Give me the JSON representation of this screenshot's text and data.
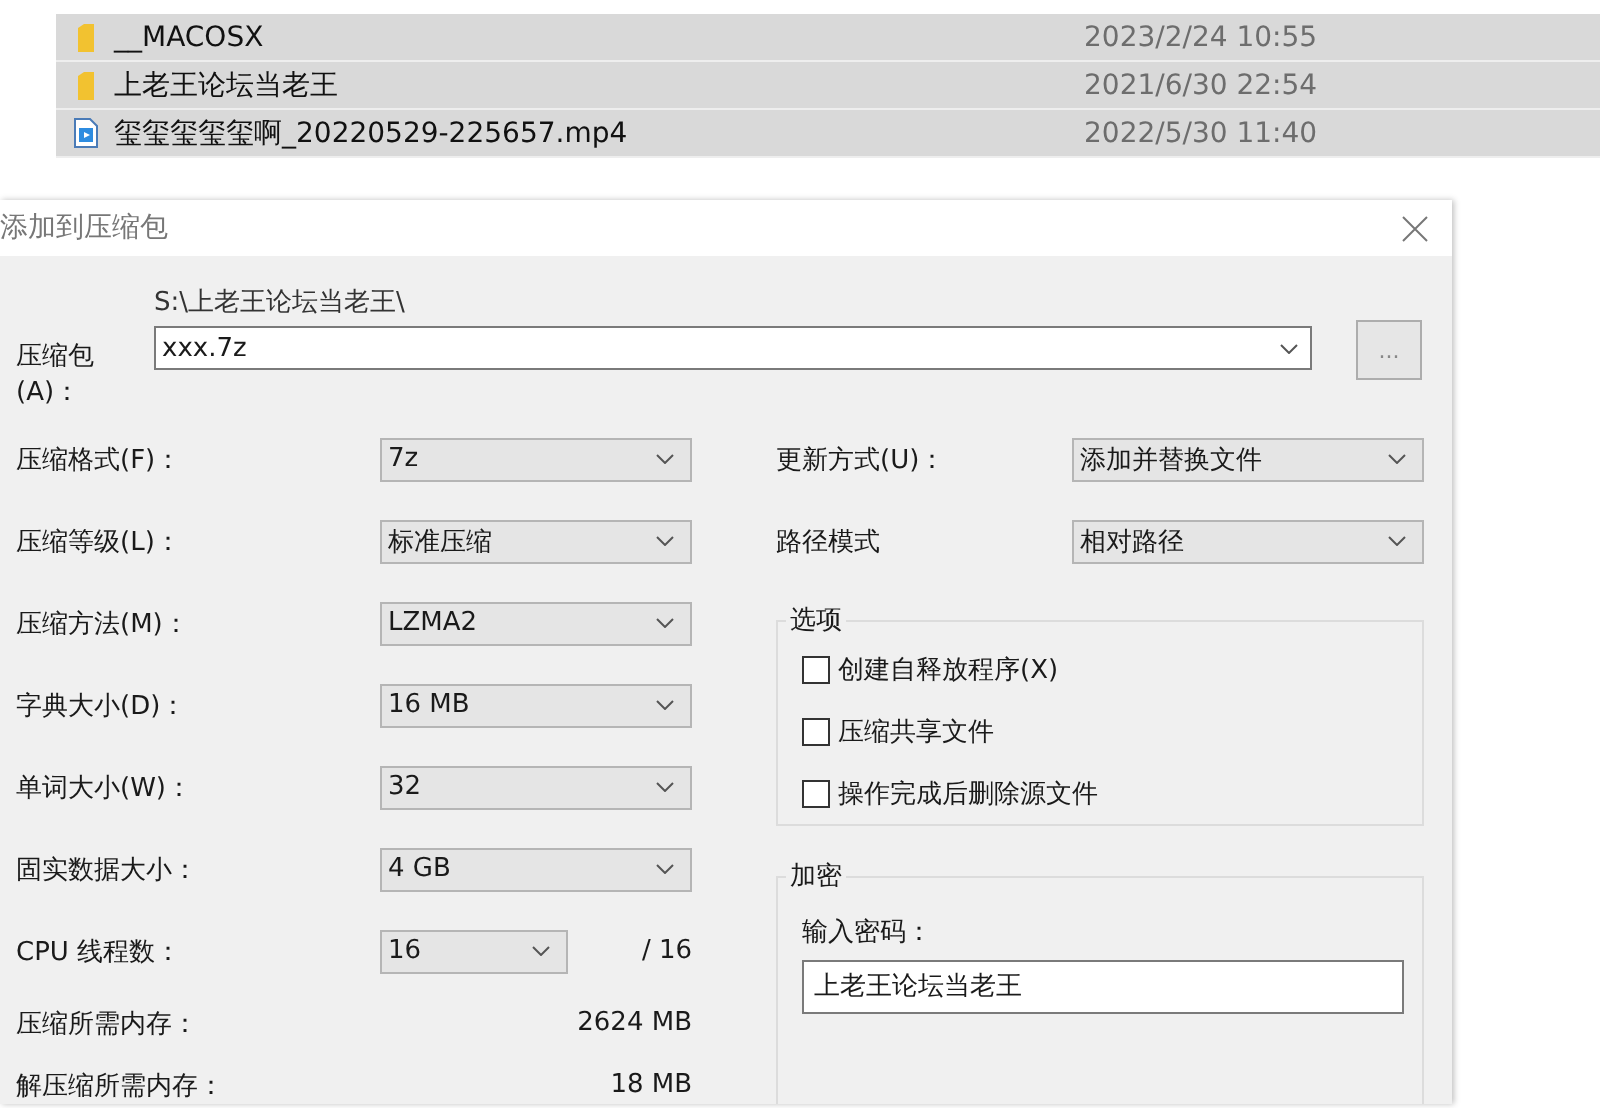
{
  "files": [
    {
      "name": "__MACOSX",
      "date": "2023/2/24 10:55",
      "kind": "folder",
      "selected": true
    },
    {
      "name": "上老王论坛当老王",
      "date": "2021/6/30 22:54",
      "kind": "folder",
      "selected": true
    },
    {
      "name": "玺玺玺玺玺啊_20220529-225657.mp4",
      "date": "2022/5/30 11:40",
      "kind": "video",
      "selected": true
    }
  ],
  "dialog": {
    "title": "添加到压缩包",
    "archive": {
      "label": "压缩包(A)：",
      "path": "S:\\上老王论坛当老王\\",
      "value": "xxx.7z",
      "browse": "..."
    },
    "left_fields": [
      {
        "label": "压缩格式(F)：",
        "value": "7z"
      },
      {
        "label": "压缩等级(L)：",
        "value": "标准压缩"
      },
      {
        "label": "压缩方法(M)：",
        "value": "LZMA2"
      },
      {
        "label": "字典大小(D)：",
        "value": "16 MB"
      },
      {
        "label": "单词大小(W)：",
        "value": "32"
      },
      {
        "label": "固实数据大小：",
        "value": "4 GB"
      },
      {
        "label": "CPU 线程数：",
        "value": "16",
        "suffix": "/ 16"
      }
    ],
    "memory": [
      {
        "label": "压缩所需内存：",
        "value": "2624 MB"
      },
      {
        "label": "解压缩所需内存：",
        "value": "18 MB"
      }
    ],
    "right_fields": [
      {
        "label": "更新方式(U)：",
        "value": "添加并替换文件"
      },
      {
        "label": "路径模式",
        "value": "相对路径"
      }
    ],
    "options": {
      "title": "选项",
      "items": [
        {
          "label": "创建自释放程序(X)",
          "checked": false
        },
        {
          "label": "压缩共享文件",
          "checked": false
        },
        {
          "label": "操作完成后删除源文件",
          "checked": false
        }
      ]
    },
    "encryption": {
      "title": "加密",
      "label": "输入密码：",
      "value": "上老王论坛当老王"
    }
  }
}
